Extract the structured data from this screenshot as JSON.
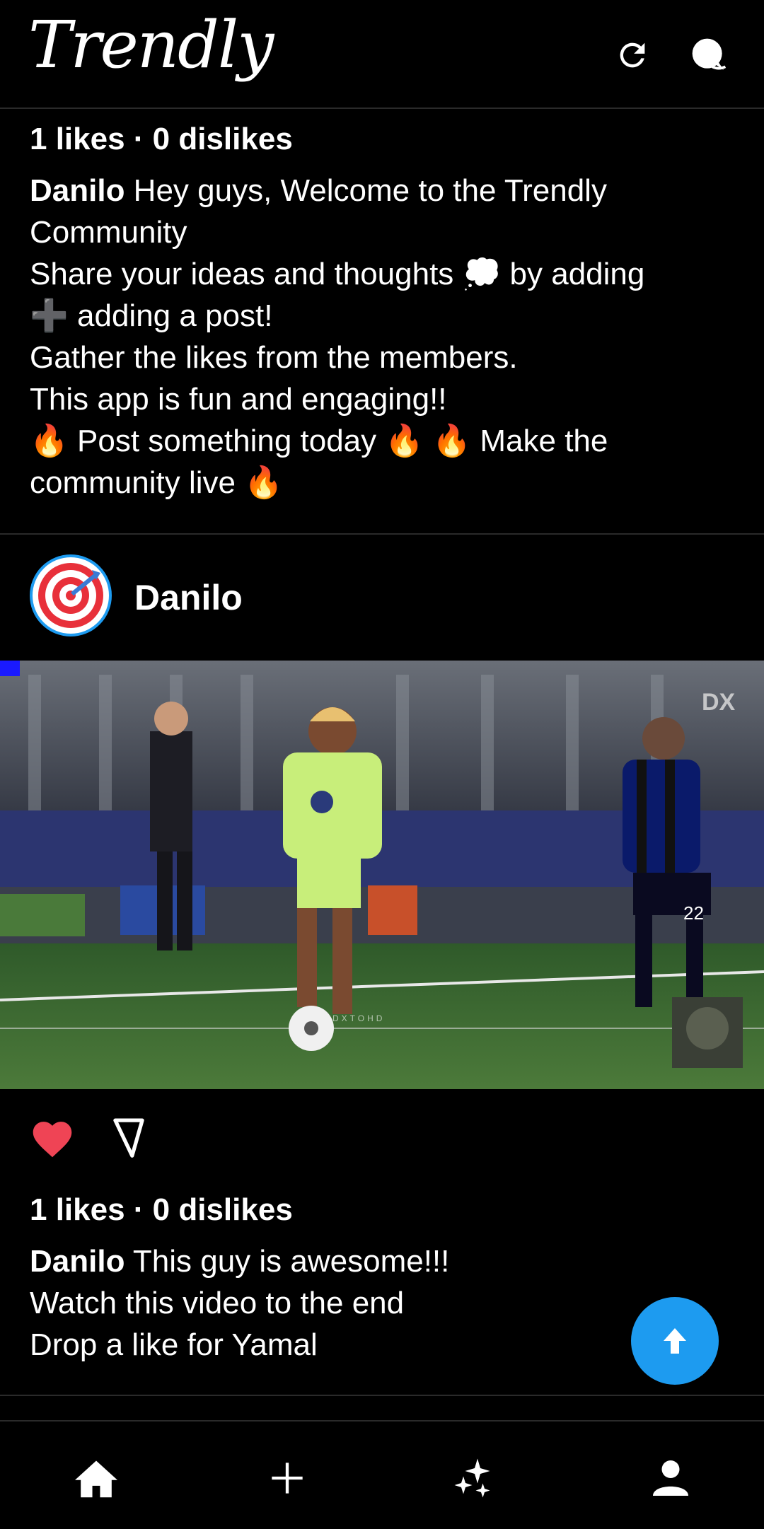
{
  "app": {
    "title": "Trendly"
  },
  "colors": {
    "accent": "#1d9bf0",
    "like": "#ef4455",
    "background": "#000000"
  },
  "icons": {
    "refresh": "refresh-icon",
    "chat": "chat-icon",
    "like": "heart-icon",
    "dislike": "dislike-icon",
    "fab": "arrow-up-icon",
    "home": "home-icon",
    "add": "add-icon",
    "ai": "sparkle-icon",
    "profile": "person-icon"
  },
  "post1": {
    "counts": "1 likes · 0 dislikes",
    "author": "Danilo",
    "caption_first": " Hey guys, Welcome to the Trendly Community",
    "line2": "Share your ideas and thoughts 💭 by adding",
    "line3": "➕ adding a post!",
    "line4": "Gather the likes from the members.",
    "line5": "This app is fun and engaging!!",
    "line6": "🔥 Post something today 🔥 🔥 Make the community live 🔥"
  },
  "post2": {
    "author": "Danilo",
    "media_watermark": "DX",
    "media_caption": "DXTOHD",
    "player_number": "22",
    "counts": "1 likes · 0 dislikes",
    "caption_first": " This guy is awesome!!!",
    "line2": "Watch this video to the end",
    "line3": "Drop a like for Yamal"
  }
}
